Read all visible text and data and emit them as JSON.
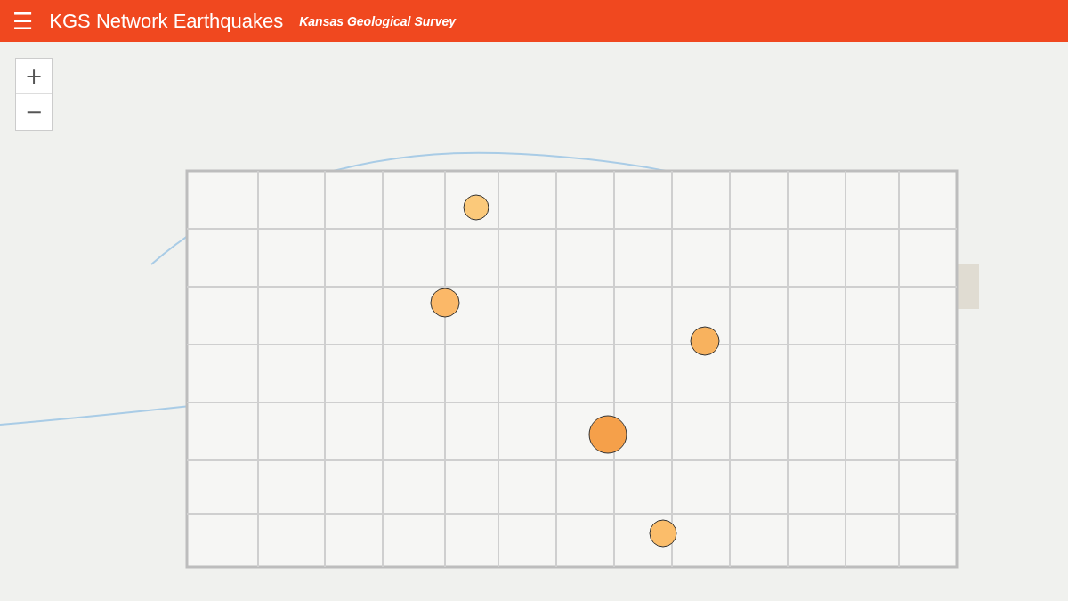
{
  "header": {
    "menu_icon": "☰",
    "title": "KGS Network Earthquakes",
    "subtitle": "Kansas Geological Survey"
  },
  "map": {
    "kind": "picture",
    "zoom_controls": [
      "+",
      "−"
    ]
  }
}
